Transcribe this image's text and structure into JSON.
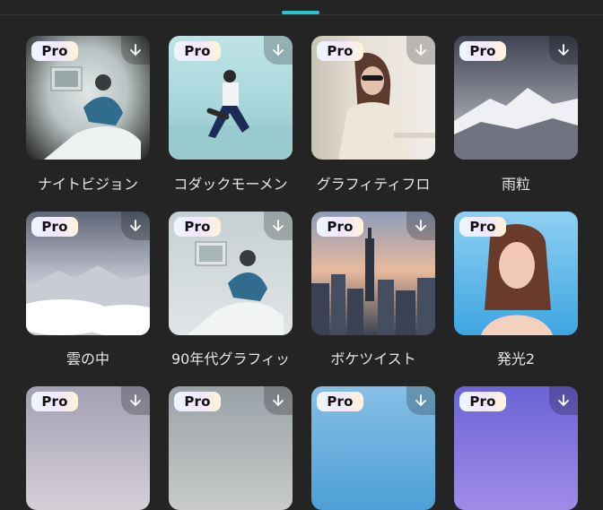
{
  "tab_indicator_color": "#25c6cf",
  "badge_text": "Pro",
  "rows": [
    [
      {
        "label": "ナイトビジョン",
        "badge": "Pro",
        "download": true
      },
      {
        "label": "コダックモーメン",
        "badge": "Pro",
        "download": true
      },
      {
        "label": "グラフィティフロ",
        "badge": "Pro",
        "download": true
      },
      {
        "label": "雨粒",
        "badge": "Pro",
        "download": true
      }
    ],
    [
      {
        "label": "雲の中",
        "badge": "Pro",
        "download": true
      },
      {
        "label": "90年代グラフィッ",
        "badge": "Pro",
        "download": true
      },
      {
        "label": "ボケツイスト",
        "badge": "Pro",
        "download": true
      },
      {
        "label": "発光2",
        "badge": "Pro",
        "download": false
      }
    ],
    [
      {
        "label": "",
        "badge": "Pro",
        "download": true
      },
      {
        "label": "",
        "badge": "Pro",
        "download": true
      },
      {
        "label": "",
        "badge": "Pro",
        "download": true
      },
      {
        "label": "",
        "badge": "Pro",
        "download": true
      }
    ]
  ]
}
